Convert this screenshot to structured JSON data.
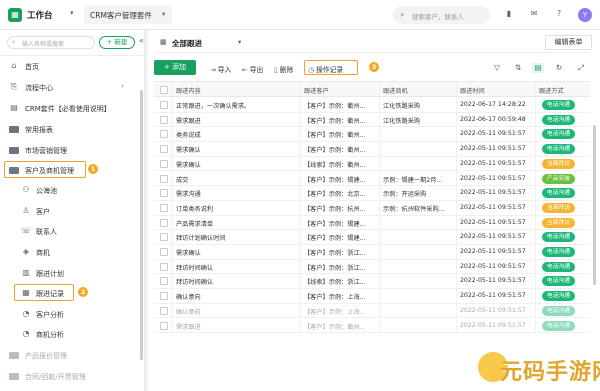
{
  "topbar": {
    "logo_glyph": "▦",
    "workspace": "工作台",
    "app_tab": "CRM客户管理套件",
    "search_placeholder": "搜索客户，联系人",
    "avatar_letter": "Y"
  },
  "sidebar": {
    "search_placeholder": "输入名称或搜索",
    "new_label": "+ 新建",
    "items": [
      {
        "label": "首页",
        "icon": "home-icon"
      },
      {
        "label": "流程中心",
        "icon": "flow-icon"
      },
      {
        "label": "CRM套件【必看使用说明】",
        "icon": "doc-icon"
      },
      {
        "label": "常用报表",
        "icon": "folder-icon"
      },
      {
        "label": "市场营销管理",
        "icon": "folder-icon"
      },
      {
        "label": "客户及商机管理",
        "icon": "folder-icon"
      },
      {
        "label": "公海池",
        "icon": "pool-icon"
      },
      {
        "label": "客户",
        "icon": "person-icon"
      },
      {
        "label": "联系人",
        "icon": "contact-icon"
      },
      {
        "label": "商机",
        "icon": "opportunity-icon"
      },
      {
        "label": "跟进计划",
        "icon": "plan-icon"
      },
      {
        "label": "跟进记录",
        "icon": "record-icon"
      },
      {
        "label": "客户分析",
        "icon": "chart-icon"
      },
      {
        "label": "商机分析",
        "icon": "chart-icon"
      },
      {
        "label": "产品报价管理",
        "icon": "folder-icon"
      },
      {
        "label": "合同/回款/开票管理",
        "icon": "folder-icon"
      }
    ],
    "markers": {
      "customer_mgmt": "1",
      "follow_record": "2"
    }
  },
  "content": {
    "view_name": "全部跟进",
    "edit_button": "编辑表单",
    "toolbar": {
      "add": "+ 添加",
      "import": "导入",
      "export": "导出",
      "delete": "删除",
      "log": "操作记录",
      "marker": "3"
    },
    "columns": [
      "跟进内容",
      "跟进客户",
      "跟进商机",
      "跟进时间",
      "跟进方式"
    ],
    "rows": [
      {
        "content": "正常跟进，一次确认需求。",
        "customer": "【客户】示例：衢州...",
        "opp": "江化铁路采购",
        "time": "2022-06-17 14:28:22",
        "method": "电话沟通"
      },
      {
        "content": "需求跟进",
        "customer": "【客户】示例：衢州...",
        "opp": "江化铁路采购",
        "time": "2022-06-17 00:59:48",
        "method": "电话沟通"
      },
      {
        "content": "类务说成",
        "customer": "【客户】示例：衢州...",
        "opp": "",
        "time": "2022-05-11 09:51:57",
        "method": "电话沟通"
      },
      {
        "content": "需求确认",
        "customer": "【客户】示例：衢州...",
        "opp": "",
        "time": "2022-05-11 09:51:57",
        "method": "电话沟通"
      },
      {
        "content": "需求确认",
        "customer": "【线索】示例：衢州...",
        "opp": "",
        "time": "2022-05-11 09:51:57",
        "method": "当面拜访"
      },
      {
        "content": "成交",
        "customer": "【客户】示例：锡建...",
        "opp": "示例：锡建一期2月...",
        "time": "2022-05-11 09:51:57",
        "method": "产品安装"
      },
      {
        "content": "需求沟通",
        "customer": "【客户】示例：北京...",
        "opp": "示例：开运采购",
        "time": "2022-05-11 09:51:57",
        "method": "电话沟通"
      },
      {
        "content": "订单类务说利",
        "customer": "【客户】示例：杭州...",
        "opp": "示例：杭州软件采购...",
        "time": "2022-05-11 09:51:57",
        "method": "当面拜访"
      },
      {
        "content": "产品需求清单",
        "customer": "【客户】示例：锡建...",
        "opp": "",
        "time": "2022-05-11 09:51:57",
        "method": "当面拜访"
      },
      {
        "content": "拜访计划确认时间",
        "customer": "【客户】示例：锡建...",
        "opp": "",
        "time": "2022-05-11 09:51:57",
        "method": "电话沟通"
      },
      {
        "content": "需求确认",
        "customer": "【客户】示例：浙江...",
        "opp": "",
        "time": "2022-05-11 09:51:57",
        "method": "电话沟通"
      },
      {
        "content": "拜访时间确认",
        "customer": "【客户】示例：浙江...",
        "opp": "",
        "time": "2022-05-11 09:51:57",
        "method": "电话沟通"
      },
      {
        "content": "拜访时间确认",
        "customer": "【线索】示例：浙江...",
        "opp": "",
        "time": "2022-05-11 09:51:57",
        "method": "电话沟通"
      },
      {
        "content": "确认意向",
        "customer": "【客户】示例：上海...",
        "opp": "",
        "time": "2022-05-11 09:51:57",
        "method": "电话沟通"
      },
      {
        "content": "确认意向",
        "customer": "【客户】示例：上海...",
        "opp": "",
        "time": "2022-05-11 09:51:57",
        "method": "电话沟通"
      },
      {
        "content": "需求跟进",
        "customer": "【客户】示例：衢州...",
        "opp": "",
        "time": "2022-05-11 09:51:57",
        "method": "电话沟通"
      }
    ]
  },
  "method_colors": {
    "电话沟通": "#1fb779",
    "当面拜访": "#f5b532",
    "产品安装": "#67c23a"
  },
  "watermark": "元码手游网"
}
